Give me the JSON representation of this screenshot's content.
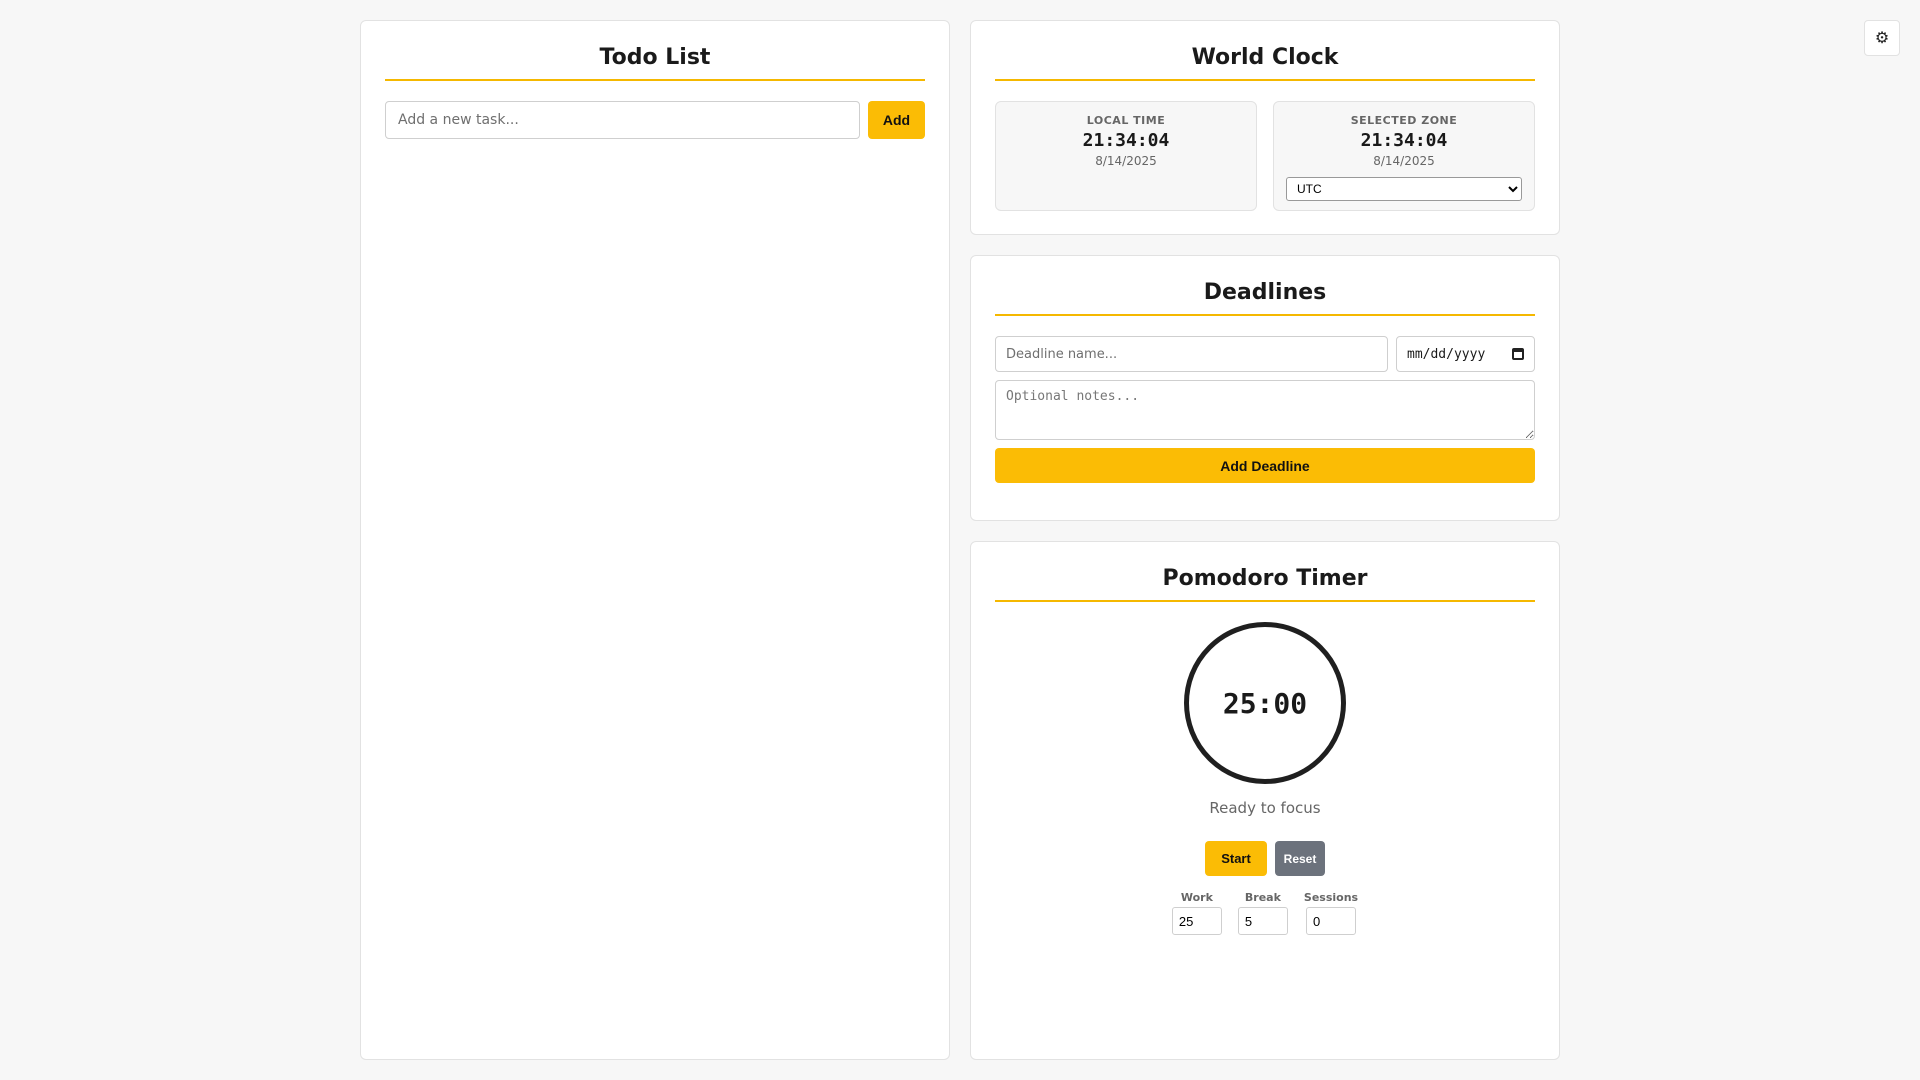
{
  "settings": {
    "icon": "gear-icon",
    "glyph": "⚙"
  },
  "todo": {
    "title": "Todo List",
    "input_placeholder": "Add a new task...",
    "add_label": "Add"
  },
  "world_clock": {
    "title": "World Clock",
    "local": {
      "label": "LOCAL TIME",
      "time": "21:34:04",
      "date": "8/14/2025"
    },
    "selected": {
      "label": "SELECTED ZONE",
      "time": "21:34:04",
      "date": "8/14/2025",
      "zone": "UTC"
    }
  },
  "deadlines": {
    "title": "Deadlines",
    "name_placeholder": "Deadline name...",
    "date_placeholder": "mm/dd/yyyy",
    "notes_placeholder": "Optional notes...",
    "add_label": "Add Deadline"
  },
  "pomodoro": {
    "title": "Pomodoro Timer",
    "time": "25:00",
    "status": "Ready to focus",
    "start_label": "Start",
    "reset_label": "Reset",
    "work": {
      "label": "Work",
      "value": "25"
    },
    "break": {
      "label": "Break",
      "value": "5"
    },
    "sessions": {
      "label": "Sessions",
      "value": "0"
    }
  },
  "colors": {
    "accent": "#fbbc05",
    "reset_button": "#6c727c",
    "background": "#f7f7f7"
  }
}
